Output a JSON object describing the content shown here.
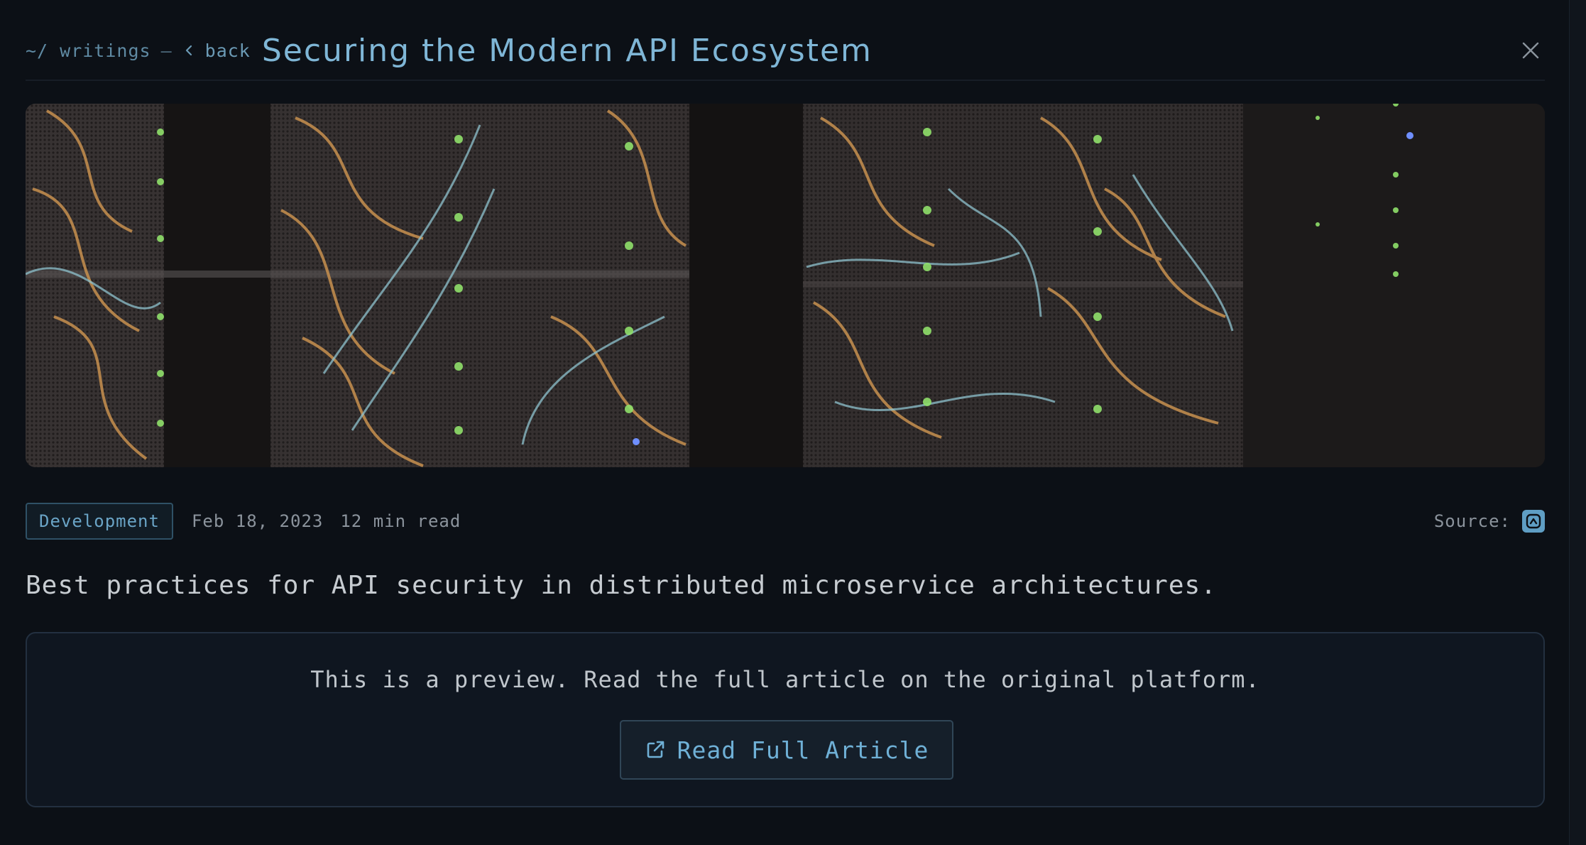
{
  "header": {
    "breadcrumb_root": "~/ writings",
    "separator": "—",
    "back_label": "back",
    "title": "Securing the Modern API Ecosystem"
  },
  "hero": {
    "icon": "server-rack-photo"
  },
  "meta": {
    "tag": "Development",
    "date": "Feb 18, 2023",
    "read_time": "12 min read",
    "source_label": "Source:",
    "source_icon": "platform-logo-icon"
  },
  "summary": "Best practices for API security in distributed microservice architectures.",
  "preview": {
    "text": "This is a preview. Read the full article on the original platform.",
    "button_label": "Read Full Article",
    "button_icon": "external-link-icon"
  },
  "colors": {
    "accent": "#6fb0d6",
    "title": "#7fb6d6",
    "background": "#0c1016",
    "tag_border": "#2f5166"
  }
}
